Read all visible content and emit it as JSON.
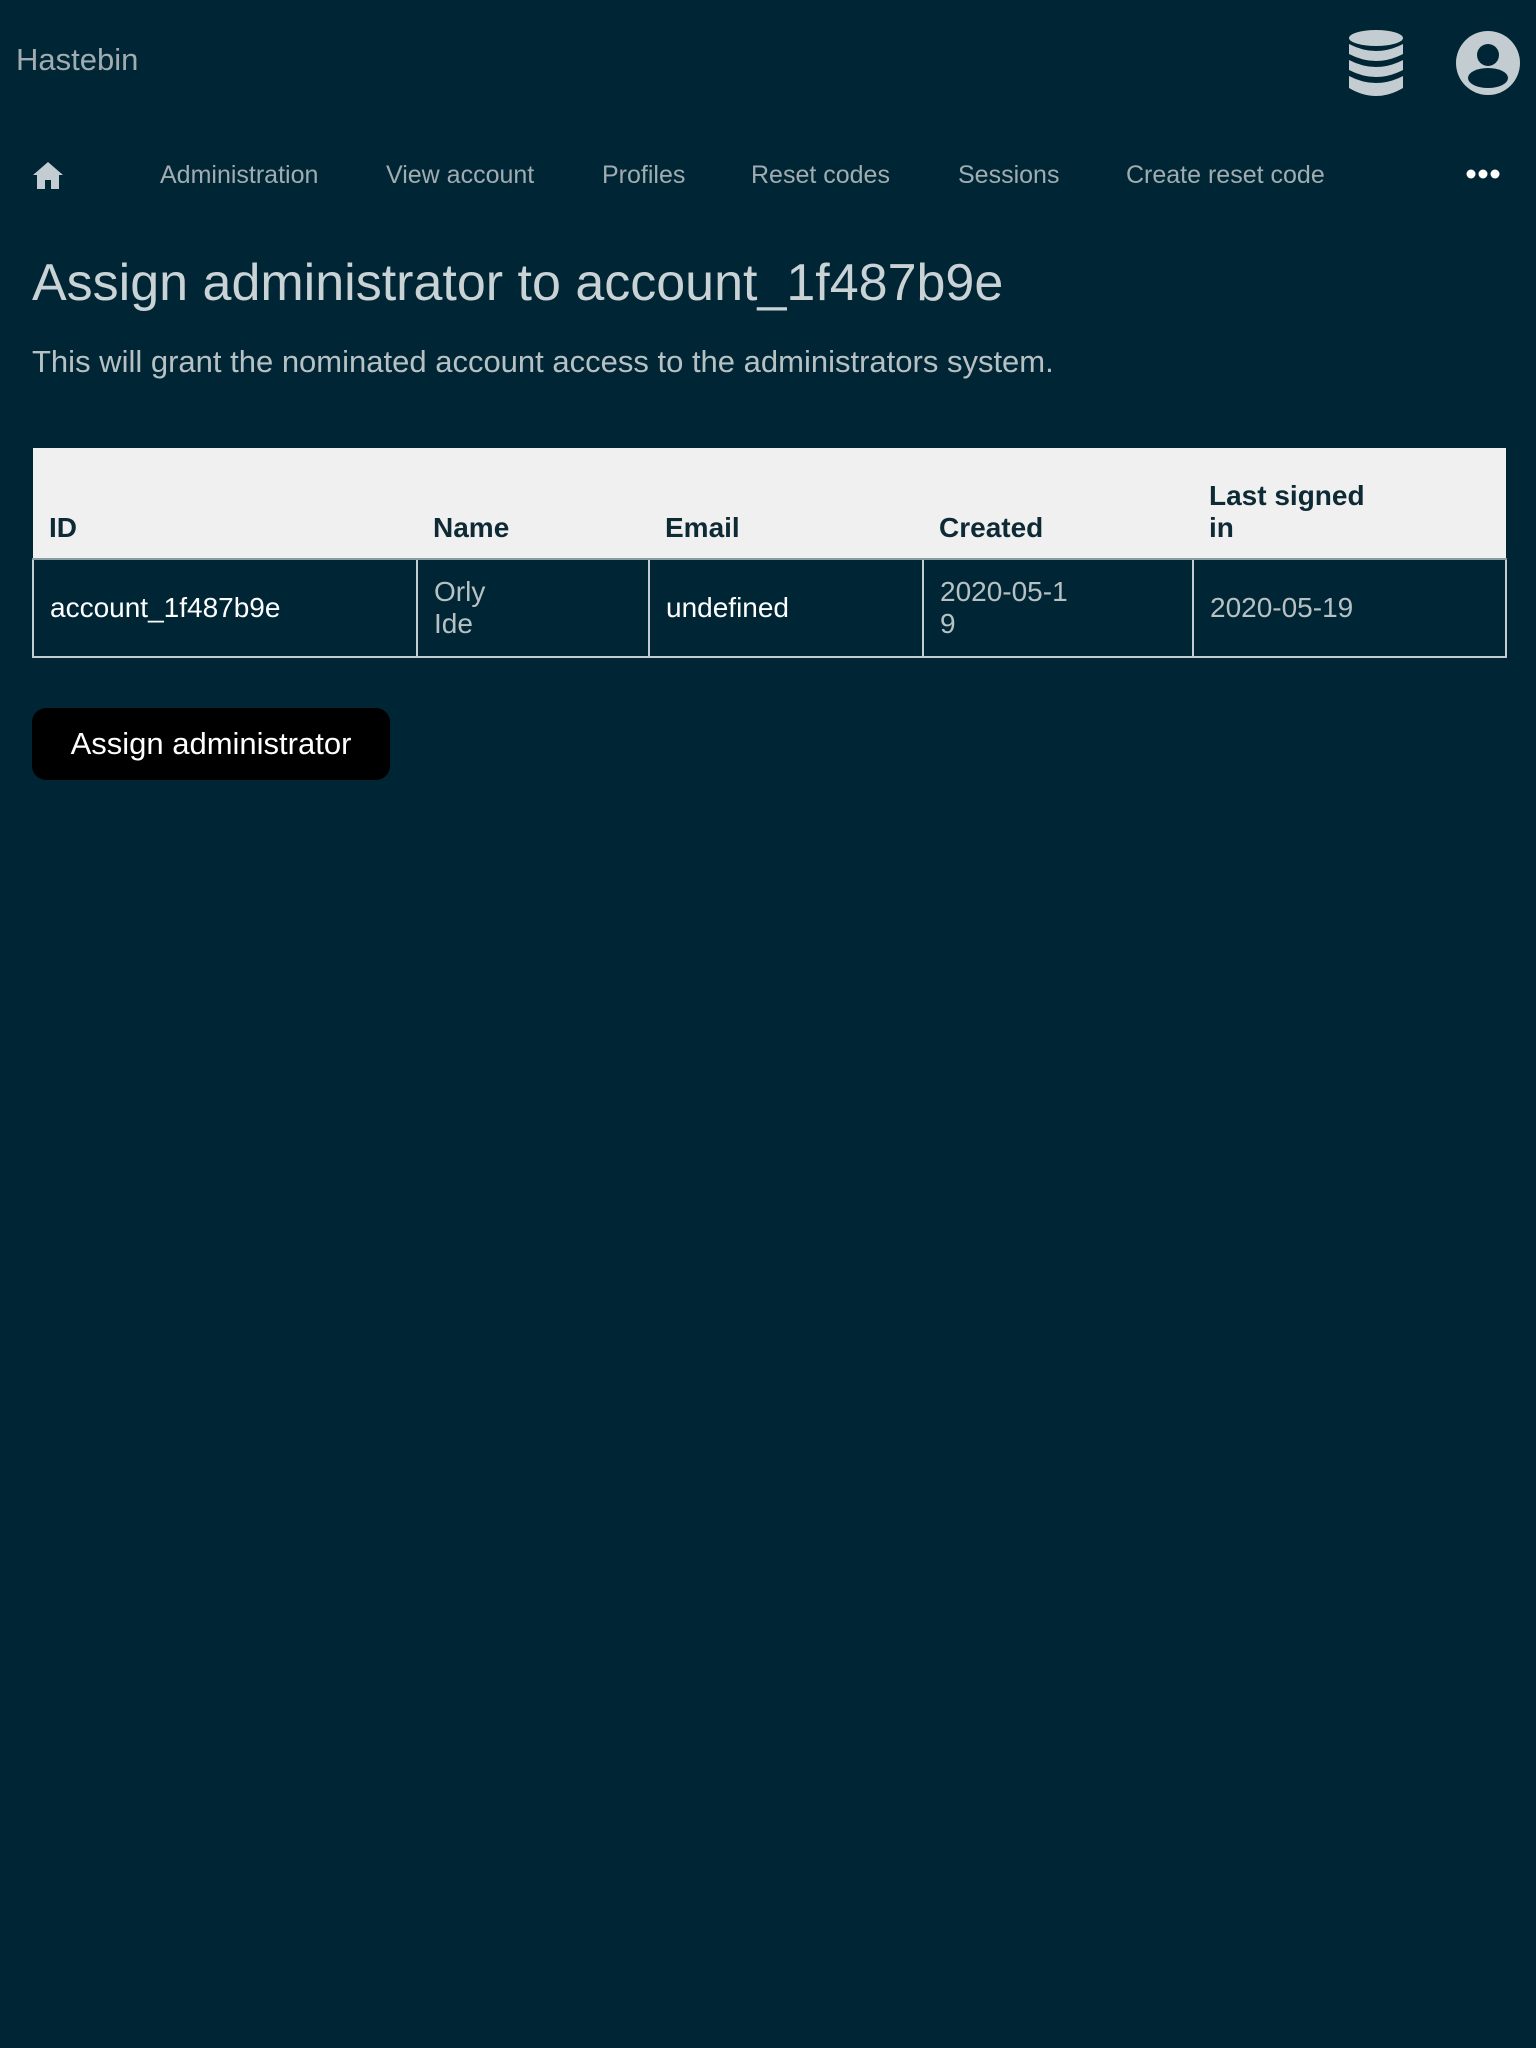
{
  "app": {
    "title": "Hastebin"
  },
  "header": {
    "icons": [
      "database-icon",
      "account-circle-icon"
    ]
  },
  "nav": {
    "home_icon": "home-icon",
    "items": [
      {
        "label": "Administration"
      },
      {
        "label": "View account"
      },
      {
        "label": "Profiles"
      },
      {
        "label": "Reset codes"
      },
      {
        "label": "Sessions"
      },
      {
        "label": "Create reset code"
      }
    ],
    "more_icon": "more-horizontal-icon"
  },
  "main": {
    "title": "Assign administrator to account_1f487b9e",
    "description": "This will grant the nominated account access to the administrators system.",
    "table": {
      "columns": [
        "ID",
        "Name",
        "Email",
        "Created",
        "Last signed in"
      ],
      "rows": [
        [
          "account_1f487b9e",
          "Orly Ide",
          "undefined",
          "2020-05-19",
          "2020-05-19"
        ]
      ]
    },
    "submit_label": "Assign administrator"
  },
  "colors": {
    "background": "#002635",
    "muted_text": "#a0acb0",
    "table_header_bg": "#f0f0f0",
    "button_bg": "#000000"
  }
}
